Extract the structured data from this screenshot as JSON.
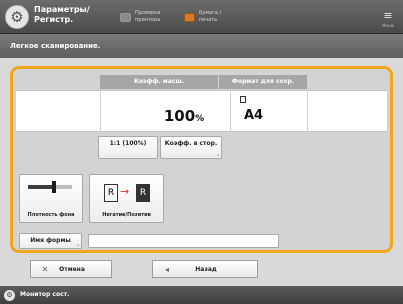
{
  "header": {
    "app_title": "Параметры/ Регистр.",
    "status_monitor_label": "Проверка принтера",
    "paper_status_label": "Бумага / печать",
    "menu_label": "Меню"
  },
  "subtitle": "Легкое сканирование.",
  "panel": {
    "zoom_header": "Коэфф. масш.",
    "paper_header": "Формат для сохр.",
    "zoom_value": "100",
    "zoom_unit": "%",
    "paper_value": "A4",
    "btn_1to1": "1:1 (100%)",
    "btn_zoom_ratio": "Коэфф. в стор.",
    "density_label": "Плотность фона",
    "orientation_label": "Негатив/Позитив",
    "doc_name_label": "Имя формы",
    "doc_name_value": "",
    "density_level_percent": 60
  },
  "bottom": {
    "cancel_label": "Отмена",
    "back_label": "Назад"
  },
  "footer": {
    "status_label": "Монитор сост."
  },
  "colors": {
    "accent": "#f0a71b",
    "header_bg": "#555555",
    "panel_bg": "#d3d3d3"
  }
}
